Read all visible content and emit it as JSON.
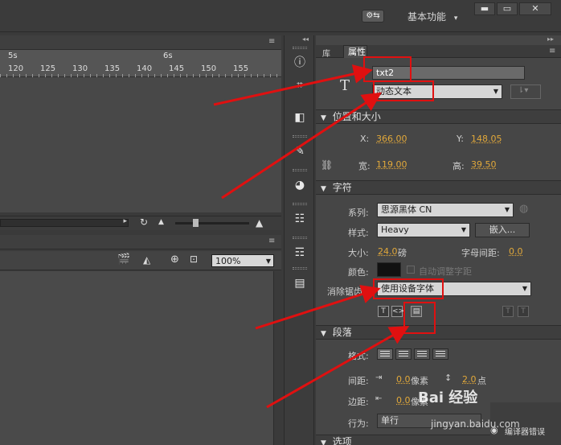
{
  "topbar": {
    "gear_label": "⚙⇆",
    "workspace_label": "基本功能",
    "workspace_caret": "▾",
    "minimize": "▬",
    "maximize": "▭",
    "close": "✕"
  },
  "timeline": {
    "seconds": [
      "5s",
      "6s"
    ],
    "ticks": [
      "120",
      "125",
      "130",
      "135",
      "140",
      "145",
      "150",
      "155"
    ]
  },
  "stage": {
    "zoom_value": "100%"
  },
  "props": {
    "tab_library": "库",
    "tab_properties": "属性",
    "instance_name": "txt2",
    "text_type": "动态文本",
    "sections": {
      "position": "位置和大小",
      "character": "字符",
      "paragraph": "段落",
      "options": "选项"
    },
    "position": {
      "x_label": "X:",
      "x_value": "366.00",
      "y_label": "Y:",
      "y_value": "148.05",
      "w_label": "宽:",
      "w_value": "119.00",
      "h_label": "高:",
      "h_value": "39.50"
    },
    "character": {
      "family_label": "系列:",
      "family_value": "思源黑体 CN",
      "style_label": "样式:",
      "style_value": "Heavy",
      "embed_button": "嵌入...",
      "size_label": "大小:",
      "size_value": "24.0",
      "size_unit": "磅",
      "spacing_label": "字母间距:",
      "spacing_value": "0.0",
      "color_label": "颜色:",
      "auto_kern_label": "自动调整字距",
      "aa_label": "消除锯齿:",
      "aa_value": "使用设备字体"
    },
    "paragraph": {
      "format_label": "格式:",
      "spacing_label": "间距:",
      "indent_value": "0.0",
      "indent_unit": "像素",
      "line_value": "2.0",
      "line_unit": "点",
      "margin_label": "边距:",
      "margin_value": "0.0",
      "margin_unit": "像素",
      "behavior_label": "行为:",
      "behavior_value": "单行"
    }
  },
  "watermark": {
    "brand": "Bai 经验",
    "url": "jingyan.baidu.com",
    "bug_label": "编译器错误"
  },
  "colors": {
    "annotation": "#e01010",
    "value_orange": "#e1a83a"
  }
}
